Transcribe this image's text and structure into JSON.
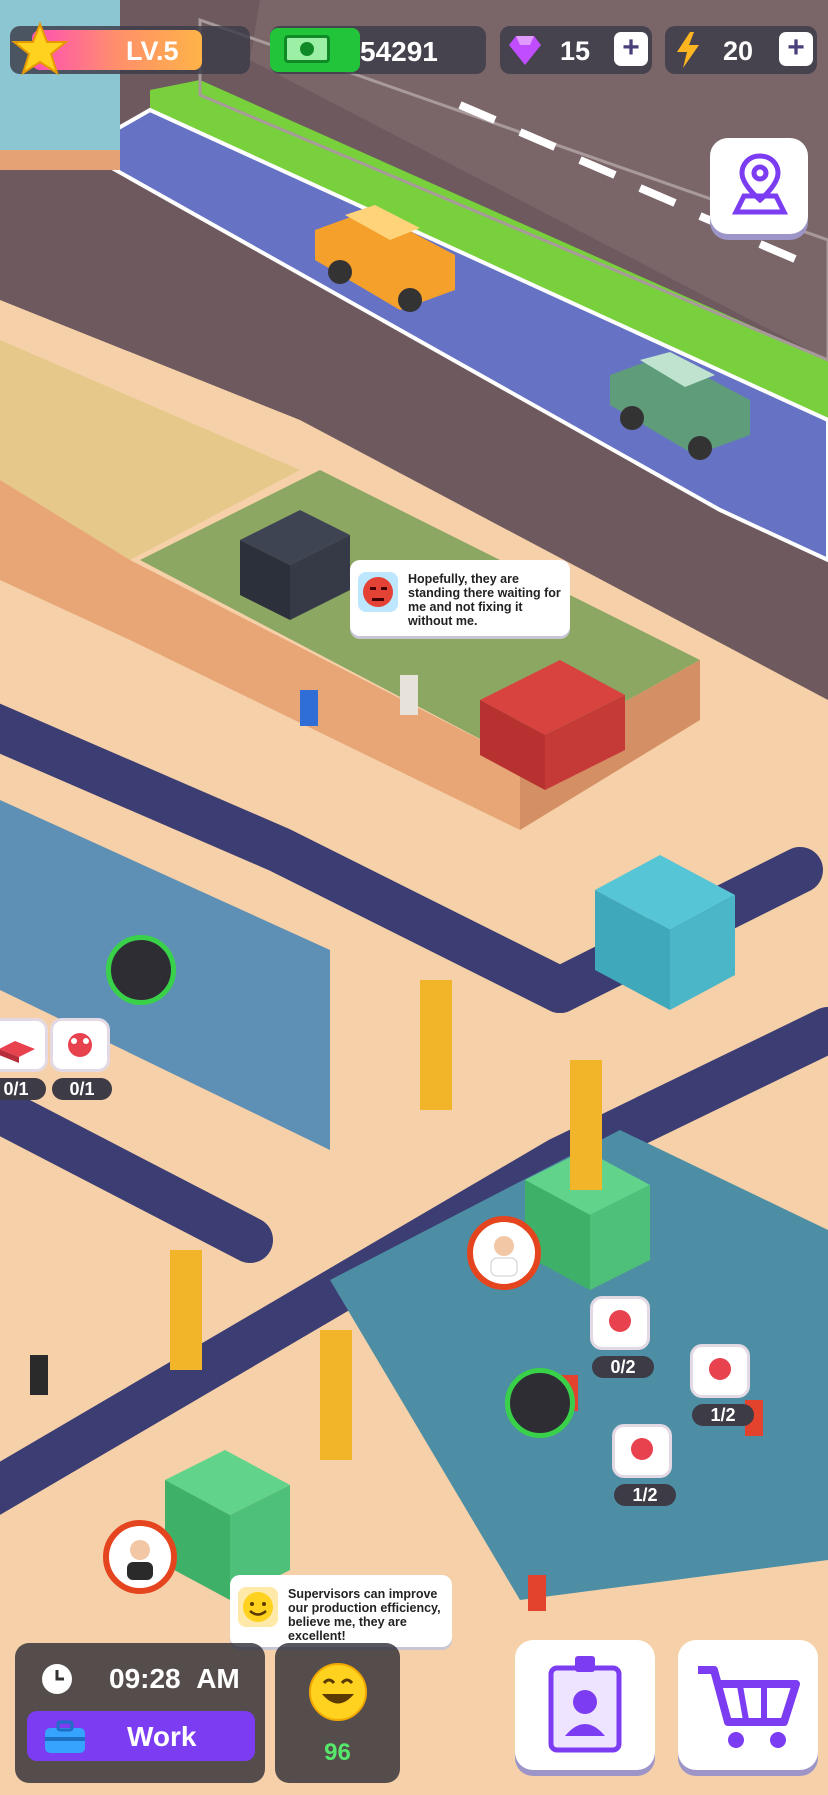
{
  "hud": {
    "level": "LV.5",
    "cash": "54291",
    "gems": "15",
    "energy": "20",
    "plus_symbol": "+"
  },
  "icons": {
    "level": "star-icon",
    "cash": "banknote-icon",
    "gems": "gem-icon",
    "energy": "lightning-icon",
    "map": "map-pin-icon",
    "staff": "employee-badge-icon",
    "shop": "shopping-cart-icon",
    "clock": "clock-icon",
    "work": "briefcase-icon",
    "mood": "happy-face-icon"
  },
  "bubbles": {
    "worker_complaint": "Hopefully, they are standing there waiting for me and not fixing it without me.",
    "supervisor_tip": "Supervisors can improve our production efficiency, believe me, they are excellent!"
  },
  "stations": {
    "left_counter_1": "0/1",
    "left_counter_2": "0/1",
    "right_counter_1": "0/2",
    "right_counter_2": "1/2",
    "right_counter_3": "1/2"
  },
  "status": {
    "time": "09:28",
    "ampm": "AM",
    "mode": "Work",
    "mood_value": "96"
  },
  "colors": {
    "accent_purple": "#7b3cf2",
    "cash_green": "#22c43a",
    "mood_green": "#55e86a"
  }
}
